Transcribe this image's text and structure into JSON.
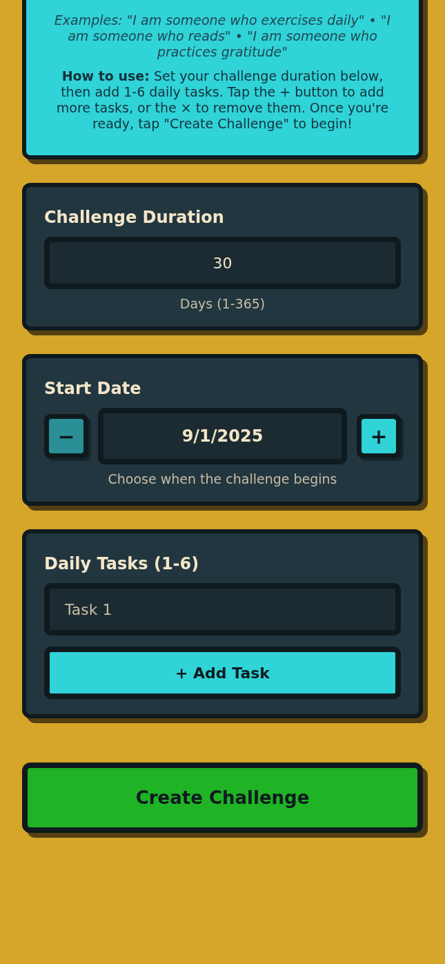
{
  "info_card": {
    "examples": "Examples: \"I am someone who exercises daily\" • \"I am someone who reads\" • \"I am someone who practices gratitude\"",
    "how_to_use": "**How to use:** Set your challenge duration below, then add 1-6 daily tasks. Tap the + button to add more tasks, or the × to remove them. Once you're ready, tap \"Create Challenge\" to begin!"
  },
  "duration": {
    "title": "Challenge Duration",
    "value": "30",
    "hint": "Days (1-365)"
  },
  "start_date": {
    "title": "Start Date",
    "decrement": {
      "label": "−",
      "disabled": true
    },
    "value": "9/1/2025",
    "increment": {
      "label": "+",
      "disabled": false
    },
    "hint": "Choose when the challenge begins"
  },
  "daily_tasks": {
    "title": "Daily Tasks (1-6)",
    "tasks": [
      {
        "placeholder": "Task 1"
      }
    ],
    "add_button": "+ Add Task"
  },
  "create_button": "Create Challenge"
}
